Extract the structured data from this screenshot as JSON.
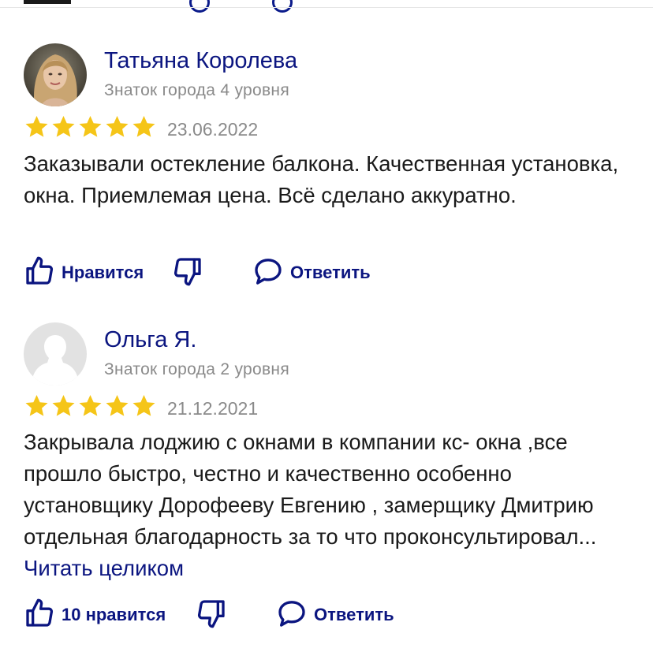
{
  "colors": {
    "accent": "#0b1580",
    "star": "#f5c518",
    "muted": "#8a8a8a",
    "text": "#1a1a1a"
  },
  "reviews": [
    {
      "author": "Татьяна Королева",
      "level": "Знаток города 4 уровня",
      "rating": 5,
      "date": "23.06.2022",
      "text": "Заказывали остекление балкона. Качественная установка, окна. Приемлемая цена. Всё сделано аккуратно.",
      "read_more": "",
      "like_label": "Нравится",
      "reply_label": "Ответить",
      "avatar_icon": "user-photo-icon"
    },
    {
      "author": "Ольга Я.",
      "level": "Знаток города 2 уровня",
      "rating": 5,
      "date": "21.12.2021",
      "text": "Закрывала лоджию с окнами в компании кс- окна ,все прошло быстро, честно и качественно особенно установщику Дорофееву Евгению , замерщику Дмитрию отдельная благодарность за то что проконсультировал...",
      "read_more": "Читать целиком",
      "like_label": "10 нравится",
      "reply_label": "Ответить",
      "avatar_icon": "default-avatar-icon"
    }
  ]
}
